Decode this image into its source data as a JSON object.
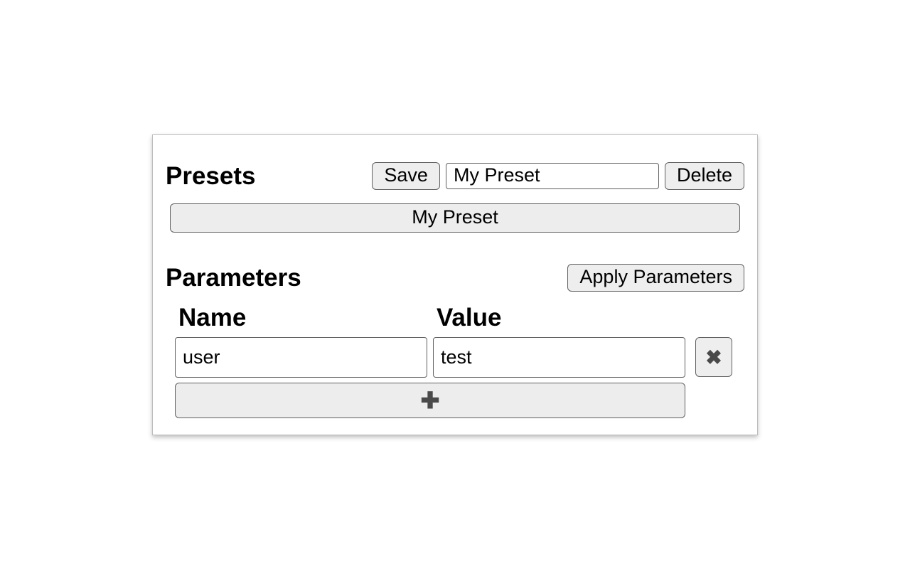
{
  "presets": {
    "title": "Presets",
    "save_label": "Save",
    "delete_label": "Delete",
    "name_input_value": "My Preset",
    "items": [
      {
        "label": "My Preset"
      }
    ]
  },
  "parameters": {
    "title": "Parameters",
    "apply_label": "Apply Parameters",
    "columns": {
      "name": "Name",
      "value": "Value"
    },
    "rows": [
      {
        "name": "user",
        "value": "test"
      }
    ],
    "delete_icon": "✖",
    "add_icon": "✚"
  }
}
